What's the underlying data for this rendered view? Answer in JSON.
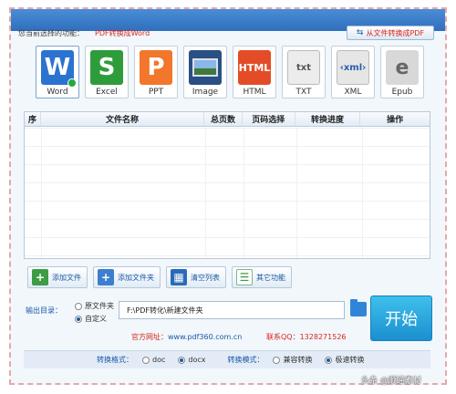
{
  "header": {
    "function_label": "您当前选择的功能：",
    "function_value": "PDF转换成Word",
    "reverse_button": "从文件转换成PDF"
  },
  "formats": [
    {
      "key": "word",
      "label": "Word",
      "glyph": "W",
      "selected": true
    },
    {
      "key": "excel",
      "label": "Excel",
      "glyph": "S"
    },
    {
      "key": "ppt",
      "label": "PPT",
      "glyph": "P"
    },
    {
      "key": "image",
      "label": "Image",
      "glyph": ""
    },
    {
      "key": "html",
      "label": "HTML",
      "glyph": "HTML"
    },
    {
      "key": "txt",
      "label": "TXT",
      "glyph": "txt"
    },
    {
      "key": "xml",
      "label": "XML",
      "glyph": "‹xml›"
    },
    {
      "key": "epub",
      "label": "Epub",
      "glyph": "e"
    }
  ],
  "table": {
    "columns": [
      "序",
      "文件名称",
      "总页数",
      "页码选择",
      "转换进度",
      "操作"
    ],
    "rows": []
  },
  "actions": {
    "add_file": "添加文件",
    "add_folder": "添加文件夹",
    "clear_list": "清空列表",
    "other": "其它功能"
  },
  "output": {
    "label": "输出目录：",
    "option_source": "原文件夹",
    "option_custom": "自定义",
    "selected": "custom",
    "path": "F:\\PDF转化\\新建文件夹"
  },
  "start_button": "开始",
  "footer": {
    "website_label": "官方网址：",
    "website": "www.pdf360.com.cn",
    "qq_label": "联系QQ：",
    "qq": "1328271526"
  },
  "bottom_bar": {
    "format_label": "转换格式：",
    "format_options": [
      "doc",
      "docx"
    ],
    "format_selected": "docx",
    "mode_label": "转换模式：",
    "mode_options": [
      "兼容转换",
      "极速转换"
    ],
    "mode_selected": "极速转换"
  },
  "watermark": "头条 @顺通素材",
  "colors": {
    "accent": "#1a58a8",
    "highlight": "#d9261c",
    "start": "#1b8fd0"
  }
}
